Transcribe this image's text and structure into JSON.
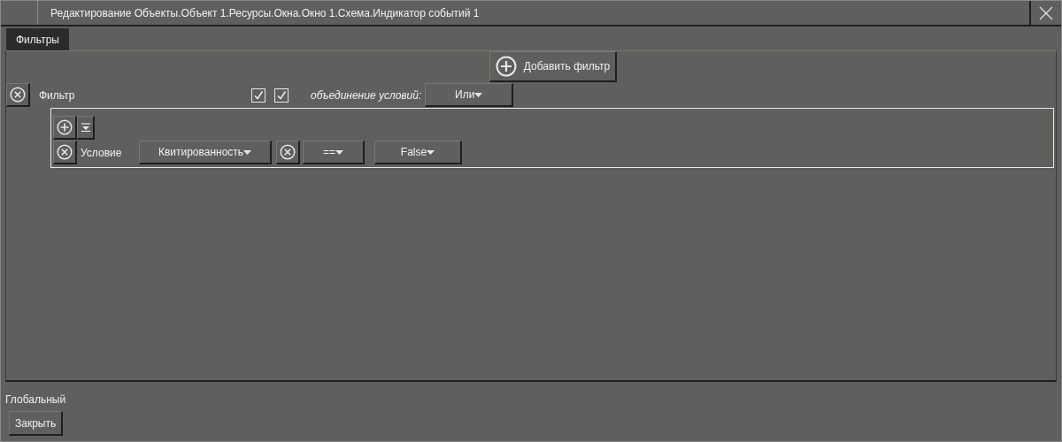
{
  "window": {
    "title": "Редактирование Объекты.Объект 1.Ресурсы.Окна.Окно 1.Схема.Индикатор событий 1"
  },
  "tabs": [
    {
      "label": "Фильтры",
      "selected": true
    }
  ],
  "add_filter_button": "Добавить фильтр",
  "filters": [
    {
      "label": "Фильтр",
      "checkboxes": [
        {
          "checked": true
        },
        {
          "checked": true
        }
      ],
      "combine_label": "объединение условий:",
      "combine_value": "Или",
      "conditions": [
        {
          "label": "Условие",
          "field": "Квитированность",
          "operator": "==",
          "value": "False"
        }
      ]
    }
  ],
  "global_label": "Глобальный",
  "close_button": "Закрыть"
}
